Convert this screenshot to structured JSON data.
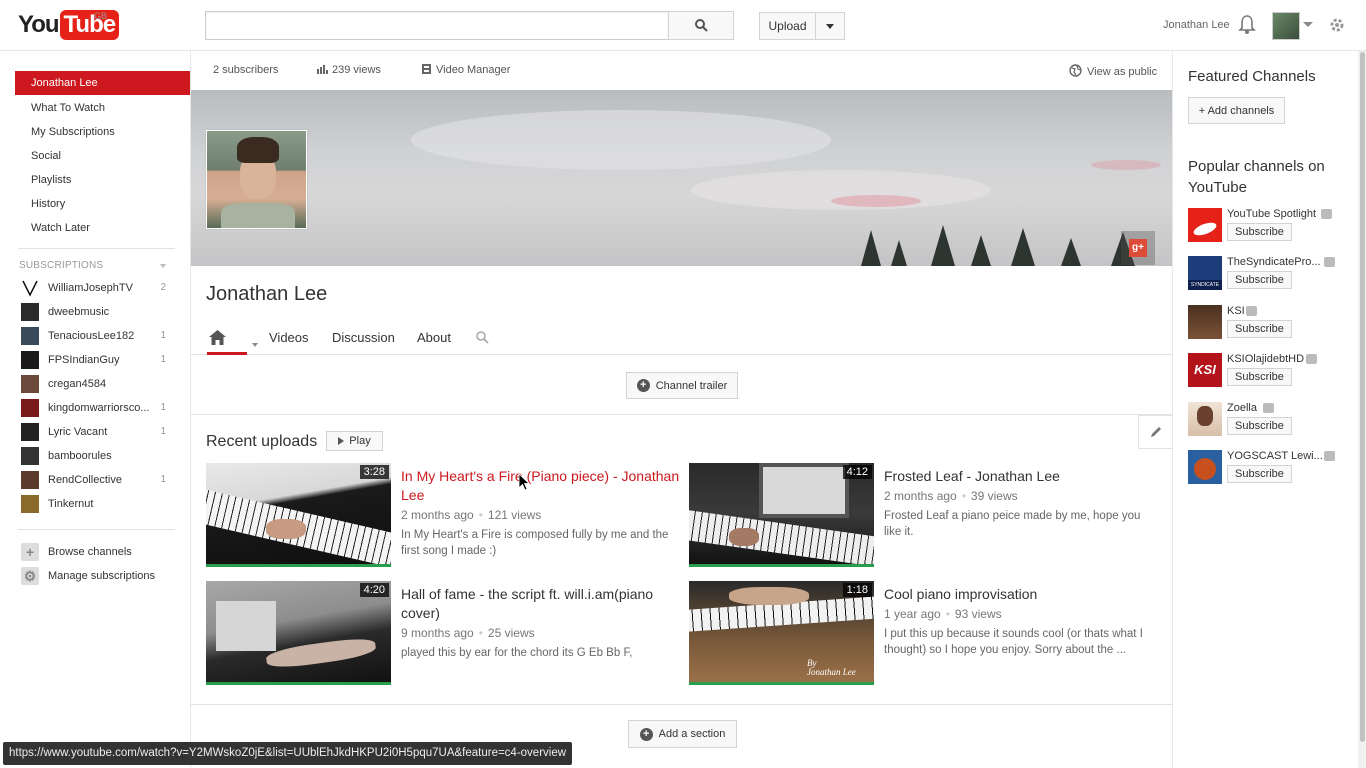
{
  "header": {
    "logo_you": "You",
    "logo_tube": "Tube",
    "logo_region": "GB",
    "search_placeholder": "",
    "upload_label": "Upload",
    "user_name": "Jonathan Lee"
  },
  "guide": {
    "items": [
      {
        "label": "Jonathan Lee",
        "active": true
      },
      {
        "label": "What To Watch"
      },
      {
        "label": "My Subscriptions"
      },
      {
        "label": "Social"
      },
      {
        "label": "Playlists"
      },
      {
        "label": "History"
      },
      {
        "label": "Watch Later"
      }
    ],
    "subscriptions_title": "SUBSCRIPTIONS",
    "subscriptions": [
      {
        "name": "WilliamJosephTV",
        "count": "2"
      },
      {
        "name": "dweebmusic",
        "count": ""
      },
      {
        "name": "TenaciousLee182",
        "count": "1"
      },
      {
        "name": "FPSIndianGuy",
        "count": "1"
      },
      {
        "name": "cregan4584",
        "count": ""
      },
      {
        "name": "kingdomwarriorsco...",
        "count": "1"
      },
      {
        "name": "Lyric Vacant",
        "count": "1"
      },
      {
        "name": "bamboorules",
        "count": ""
      },
      {
        "name": "RendCollective",
        "count": "1"
      },
      {
        "name": "Tinkernut",
        "count": ""
      }
    ],
    "browse_channels": "Browse channels",
    "manage_subscriptions": "Manage subscriptions"
  },
  "stats": {
    "subscribers": "2 subscribers",
    "views": "239 views",
    "video_manager": "Video Manager",
    "view_as_public": "View as public"
  },
  "channel": {
    "name": "Jonathan Lee",
    "tabs": [
      "Videos",
      "Discussion",
      "About"
    ],
    "trailer_label": "Channel trailer",
    "recent_uploads_title": "Recent uploads",
    "play_label": "Play",
    "add_section_label": "Add a section"
  },
  "videos": [
    {
      "title": "In My Heart's a Fire (Piano piece) - Jonathan Lee",
      "duration": "3:28",
      "age": "2 months ago",
      "views": "121 views",
      "desc": "In My Heart's a Fire is composed fully by me and the first song I made :)"
    },
    {
      "title": "Frosted Leaf - Jonathan Lee",
      "duration": "4:12",
      "age": "2 months ago",
      "views": "39 views",
      "desc": "Frosted Leaf a piano peice made by me, hope you like it."
    },
    {
      "title": "Hall of fame - the script ft. will.i.am(piano cover)",
      "duration": "4:20",
      "age": "9 months ago",
      "views": "25 views",
      "desc": "played this by ear for the chord its G Eb Bb F,"
    },
    {
      "title": "Cool piano improvisation",
      "duration": "1:18",
      "age": "1 year ago",
      "views": "93 views",
      "desc": "I put this up because it sounds cool (or thats what I thought) so I hope you enjoy. Sorry about the ..."
    }
  ],
  "sidebar_right": {
    "featured_title": "Featured Channels",
    "add_channels_label": "+ Add channels",
    "popular_title": "Popular channels on YouTube",
    "popular": [
      {
        "name": "YouTube Spotlight",
        "color": "#e62117"
      },
      {
        "name": "TheSyndicatePro...",
        "color": "#1c3c7a"
      },
      {
        "name": "KSI",
        "color": "#7a5236"
      },
      {
        "name": "KSIOlajidebtHD",
        "color": "#b3141b"
      },
      {
        "name": "Zoella",
        "color": "#e8d6c4"
      },
      {
        "name": "YOGSCAST Lewi...",
        "color": "#2a5fa0"
      }
    ],
    "subscribe_label": "Subscribe"
  },
  "status_url": "https://www.youtube.com/watch?v=Y2MWskoZ0jE&list=UUblEhJkdHKPU2i0H5pqu7UA&feature=c4-overview",
  "colors": {
    "accent": "#cc181e",
    "progress": "#2a9d4c"
  }
}
